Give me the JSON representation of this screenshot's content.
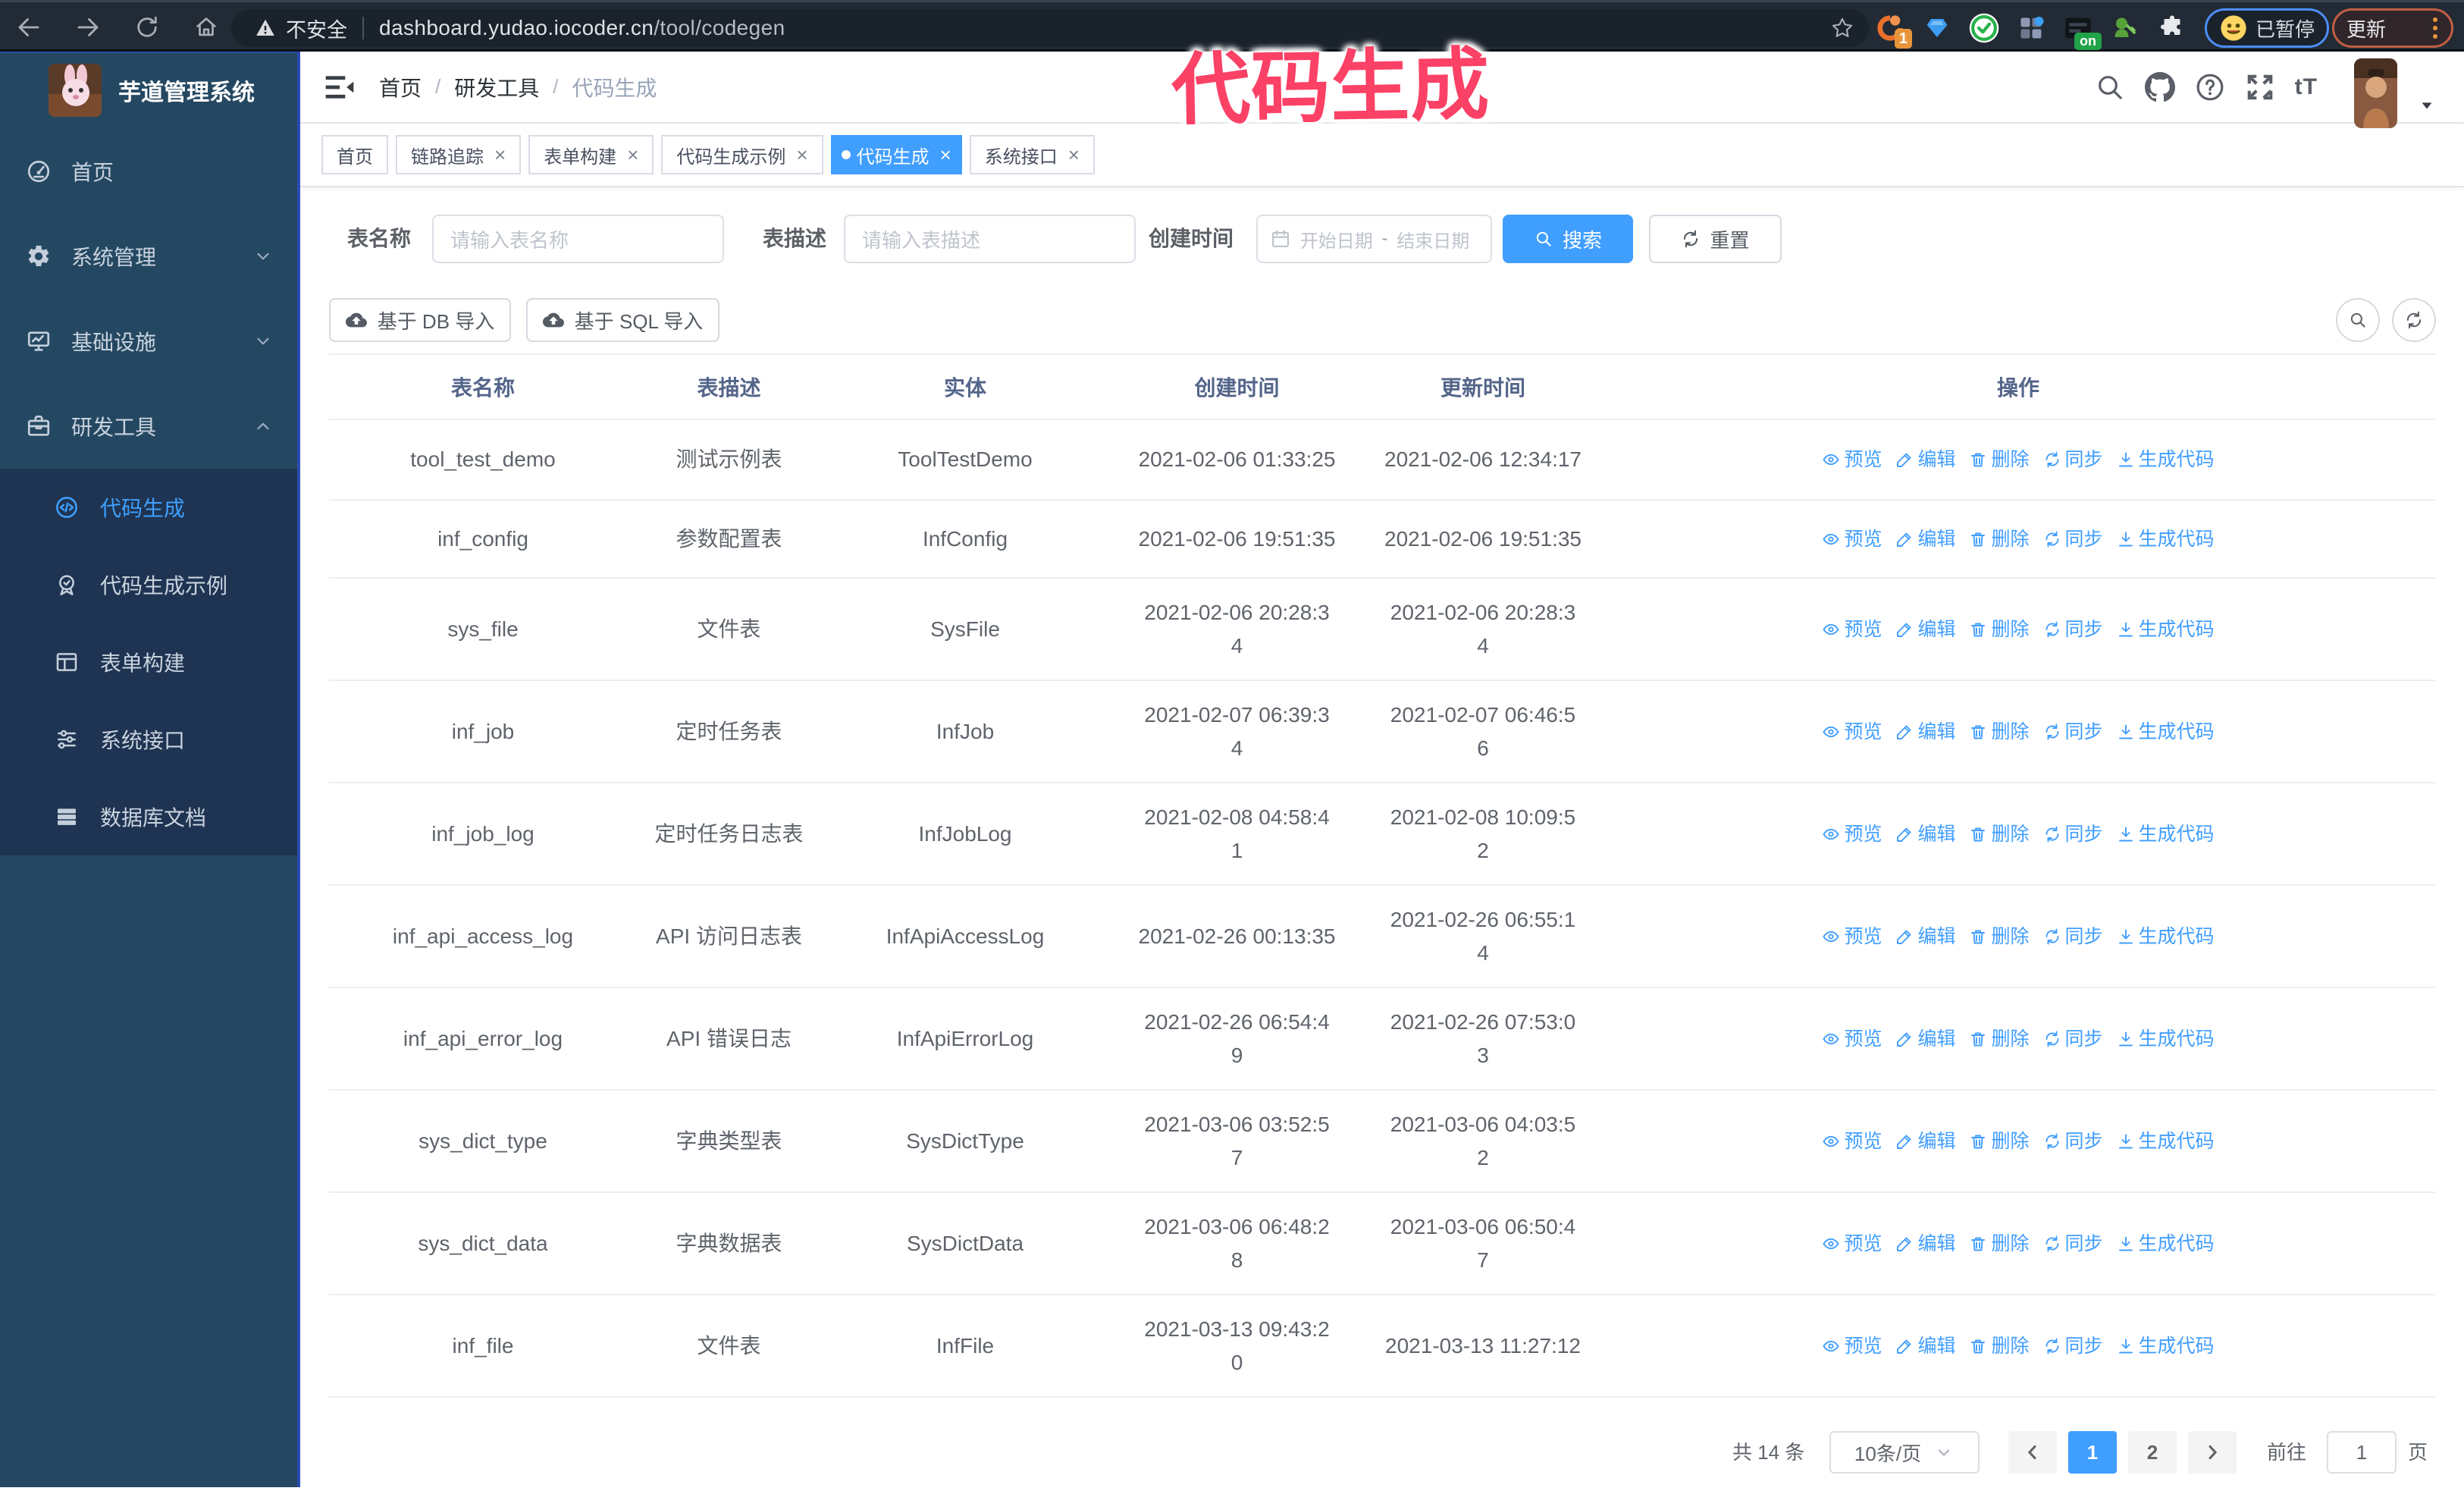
{
  "browser": {
    "security_label": "不安全",
    "url": "dashboard.yudao.iocoder.cn",
    "url_path": "/tool/codegen",
    "paused_badge": "已暂停",
    "update_button": "更新",
    "extension_on_badge": "on",
    "extension_count_badge": "1"
  },
  "annotation": "代码生成",
  "colors": {
    "accent": "#409eff",
    "sidebar_bg": "#254862",
    "submenu_bg": "#1f3452",
    "annotation": "#fb4166",
    "active_tab_bg": "#409eff"
  },
  "sidebar": {
    "title": "芋道管理系统",
    "items": [
      {
        "label": "首页",
        "icon": "dashboard-icon",
        "arrow": ""
      },
      {
        "label": "系统管理",
        "icon": "gear-icon",
        "arrow": "down"
      },
      {
        "label": "基础设施",
        "icon": "infra-icon",
        "arrow": "down"
      },
      {
        "label": "研发工具",
        "icon": "tools-icon",
        "arrow": "up"
      }
    ],
    "subitems": [
      {
        "label": "代码生成",
        "icon": "code-icon",
        "active": true
      },
      {
        "label": "代码生成示例",
        "icon": "example-icon",
        "active": false
      },
      {
        "label": "表单构建",
        "icon": "form-icon",
        "active": false
      },
      {
        "label": "系统接口",
        "icon": "api-icon",
        "active": false
      },
      {
        "label": "数据库文档",
        "icon": "db-doc-icon",
        "active": false
      }
    ]
  },
  "breadcrumb": [
    "首页",
    "研发工具",
    "代码生成"
  ],
  "tabs": [
    {
      "label": "首页",
      "closable": false,
      "active": false
    },
    {
      "label": "链路追踪",
      "closable": true,
      "active": false
    },
    {
      "label": "表单构建",
      "closable": true,
      "active": false
    },
    {
      "label": "代码生成示例",
      "closable": true,
      "active": false
    },
    {
      "label": "代码生成",
      "closable": true,
      "active": true
    },
    {
      "label": "系统接口",
      "closable": true,
      "active": false
    }
  ],
  "filters": {
    "name_label": "表名称",
    "name_placeholder": "请输入表名称",
    "desc_label": "表描述",
    "desc_placeholder": "请输入表描述",
    "time_label": "创建时间",
    "date_start_placeholder": "开始日期",
    "date_separator": "-",
    "date_end_placeholder": "结束日期",
    "search_button": "搜索",
    "reset_button": "重置"
  },
  "toolbar": {
    "import_db_button": "基于 DB 导入",
    "import_sql_button": "基于 SQL 导入"
  },
  "table": {
    "headers": [
      "表名称",
      "表描述",
      "实体",
      "创建时间",
      "更新时间",
      "操作"
    ],
    "ops": [
      "预览",
      "编辑",
      "删除",
      "同步",
      "生成代码"
    ],
    "rows": [
      {
        "name": "tool_test_demo",
        "desc": "测试示例表",
        "entity": "ToolTestDemo",
        "created": [
          "2021-02-06 01:33:25"
        ],
        "updated": [
          "2021-02-06 12:34:17"
        ]
      },
      {
        "name": "inf_config",
        "desc": "参数配置表",
        "entity": "InfConfig",
        "created": [
          "2021-02-06 19:51:35"
        ],
        "updated": [
          "2021-02-06 19:51:35"
        ]
      },
      {
        "name": "sys_file",
        "desc": "文件表",
        "entity": "SysFile",
        "created": [
          "2021-02-06 20:28:3",
          "4"
        ],
        "updated": [
          "2021-02-06 20:28:3",
          "4"
        ]
      },
      {
        "name": "inf_job",
        "desc": "定时任务表",
        "entity": "InfJob",
        "created": [
          "2021-02-07 06:39:3",
          "4"
        ],
        "updated": [
          "2021-02-07 06:46:5",
          "6"
        ]
      },
      {
        "name": "inf_job_log",
        "desc": "定时任务日志表",
        "entity": "InfJobLog",
        "created": [
          "2021-02-08 04:58:4",
          "1"
        ],
        "updated": [
          "2021-02-08 10:09:5",
          "2"
        ]
      },
      {
        "name": "inf_api_access_log",
        "desc": "API 访问日志表",
        "entity": "InfApiAccessLog",
        "created": [
          "2021-02-26 00:13:35"
        ],
        "updated": [
          "2021-02-26 06:55:1",
          "4"
        ]
      },
      {
        "name": "inf_api_error_log",
        "desc": "API 错误日志",
        "entity": "InfApiErrorLog",
        "created": [
          "2021-02-26 06:54:4",
          "9"
        ],
        "updated": [
          "2021-02-26 07:53:0",
          "3"
        ]
      },
      {
        "name": "sys_dict_type",
        "desc": "字典类型表",
        "entity": "SysDictType",
        "created": [
          "2021-03-06 03:52:5",
          "7"
        ],
        "updated": [
          "2021-03-06 04:03:5",
          "2"
        ]
      },
      {
        "name": "sys_dict_data",
        "desc": "字典数据表",
        "entity": "SysDictData",
        "created": [
          "2021-03-06 06:48:2",
          "8"
        ],
        "updated": [
          "2021-03-06 06:50:4",
          "7"
        ]
      },
      {
        "name": "inf_file",
        "desc": "文件表",
        "entity": "InfFile",
        "created": [
          "2021-03-13 09:43:2",
          "0"
        ],
        "updated": [
          "2021-03-13 11:27:12"
        ]
      }
    ]
  },
  "pagination": {
    "total": "共 14 条",
    "page_size": "10条/页",
    "pages": [
      "1",
      "2"
    ],
    "current_page": "1",
    "goto_label": "前往",
    "goto_value": "1",
    "page_suffix": "页"
  }
}
